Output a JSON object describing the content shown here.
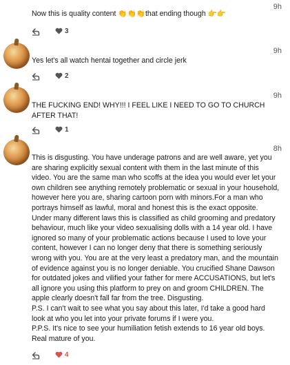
{
  "comments": [
    {
      "time": "9h",
      "text": "Now this is quality content 👏👏👏that ending though 👉👉",
      "likes": "3",
      "liked": false
    },
    {
      "time": "9h",
      "text": "Yes let's all watch hentai together and circle jerk",
      "likes": "2",
      "liked": false
    },
    {
      "time": "9h",
      "text": "THE FUCKING END! WHY!!! I FEEL LIKE I NEED TO GO TO CHURCH AFTER THAT!",
      "likes": "1",
      "liked": false
    },
    {
      "time": "8h",
      "text": "This is disgusting. You have underage patrons and are well aware, yet you are sharing explicitly sexual content with them in the last minute of this video. You are the same man who scoffs at the idea you would ever let your own children see anything remotely problematic or sexual in your household, however here you are, sharing cartoon porn with minors.For a man who portrays himself as lawful, moral and honest this is the exact opposite. Under many different laws this is classified as child grooming and predatory behaviour, much like your video sexualising dolls with a 14 year old. I have ignored so many of your problematic actions because I used to love your content, however I can no longer deny that there is something seriously wrong with you. You are at the very least a predatory man, and the mountain of evidence against you is no longer deniable. You crucified Shane Dawson for outdated jokes and vilified your father for mere ACCUSATIONS, but let's all ignore you using this platform to prey on and groom CHILDREN. The apple clearly doesn't fall far from the tree. Disgusting.\nP.S. I can't wait to see what you say about this later, I'd take a good hard look at who you let into your private forums if I were you.\nP.P.S. It's nice to see your humiliation fetish extends to 16 year old boys. Real mature of you.",
      "likes": "4",
      "liked": true
    }
  ],
  "colors": {
    "like_active": "#d9534f",
    "muted": "#555555"
  },
  "icons": {
    "reply": "reply-arrow-icon",
    "like": "heart-icon"
  }
}
